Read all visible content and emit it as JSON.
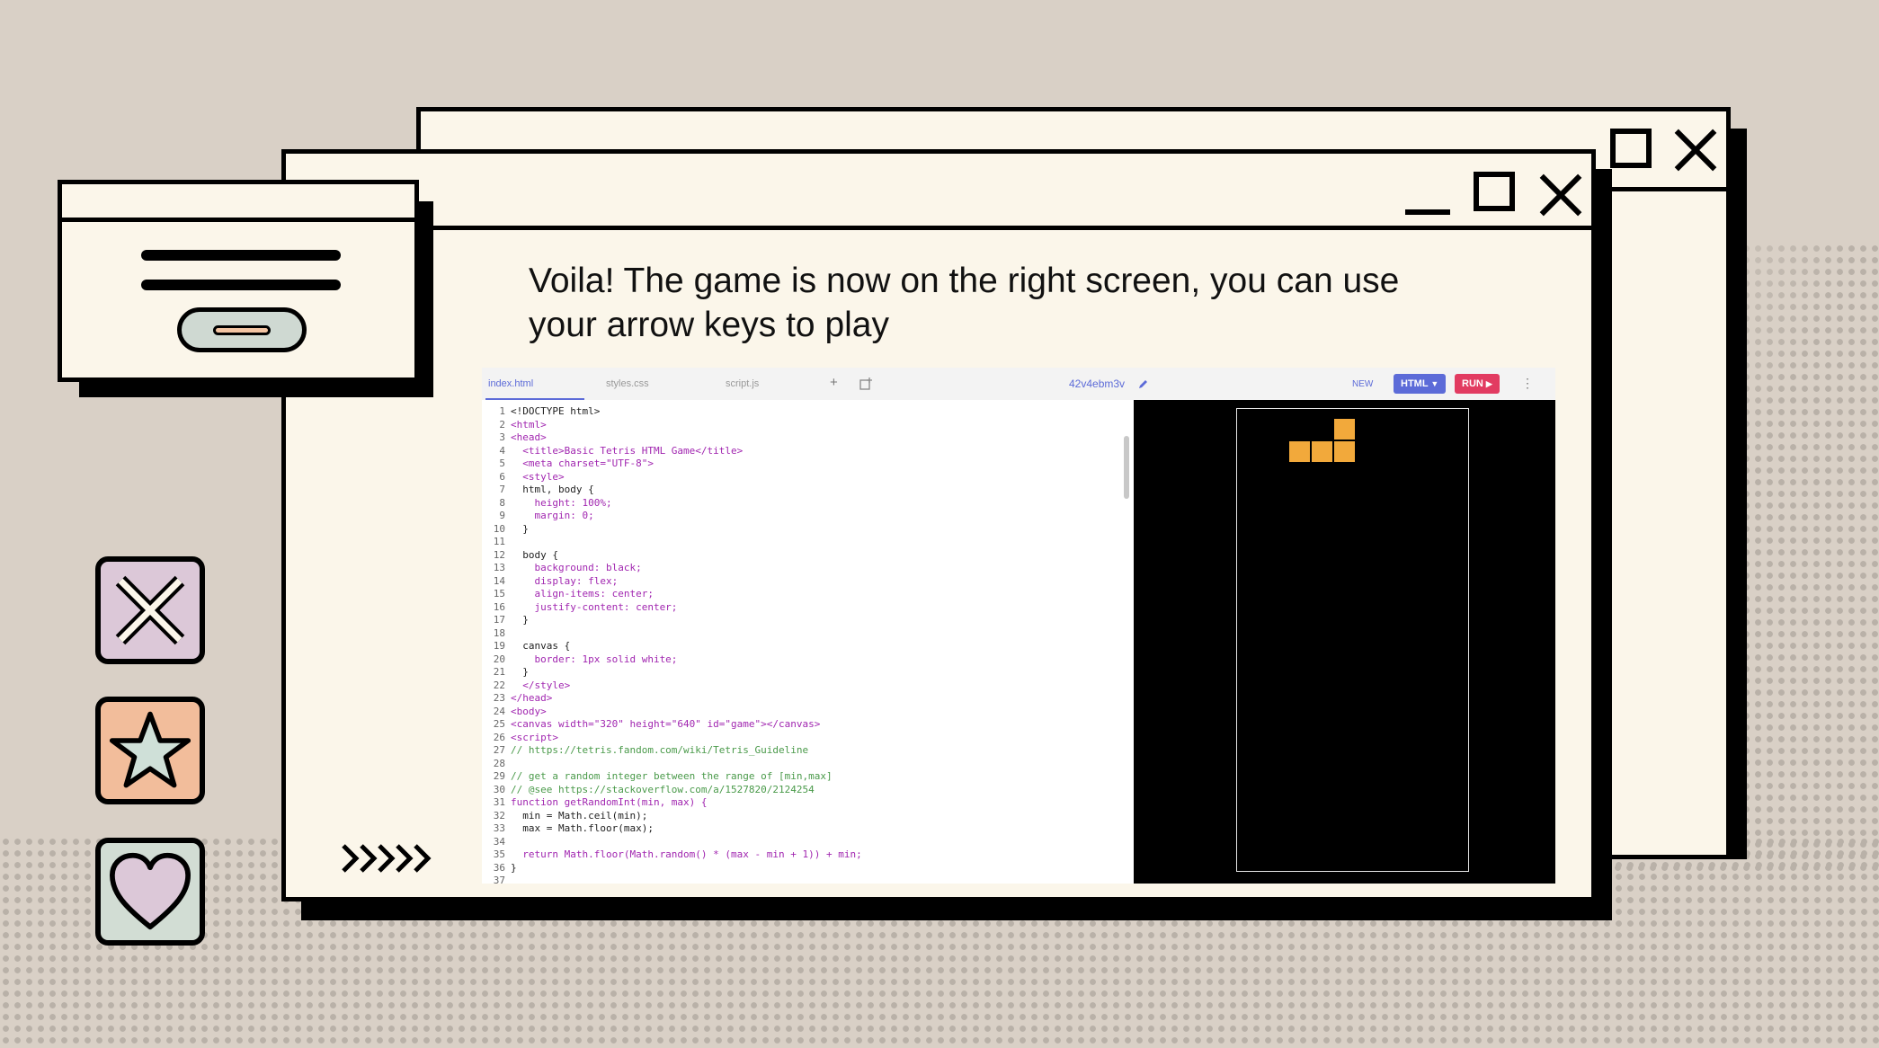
{
  "caption": {
    "line1": "Voila! The game is now on the right screen, you can use",
    "line2": "your arrow keys to play"
  },
  "side_icons": [
    "close-icon",
    "star-icon",
    "heart-icon"
  ],
  "colors": {
    "background": "#d9d0c6",
    "window": "#fbf6ea",
    "close_tile": "#dcc8d8",
    "star_tile": "#f2bd9b",
    "heart_tile": "#d2ddd4",
    "tetris_piece": "#f2a93b"
  },
  "editor": {
    "tabs": [
      "index.html",
      "styles.css",
      "script.js"
    ],
    "add_tab": "+",
    "project_id": "42v4ebm3v",
    "new_label": "NEW",
    "html_label": "HTML",
    "run_label": "RUN",
    "code_lines": [
      "<!DOCTYPE html>",
      "<html>",
      "<head>",
      "  <title>Basic Tetris HTML Game</title>",
      "  <meta charset=\"UTF-8\">",
      "  <style>",
      "  html, body {",
      "    height: 100%;",
      "    margin: 0;",
      "  }",
      "",
      "  body {",
      "    background: black;",
      "    display: flex;",
      "    align-items: center;",
      "    justify-content: center;",
      "  }",
      "",
      "  canvas {",
      "    border: 1px solid white;",
      "  }",
      "  </style>",
      "</head>",
      "<body>",
      "<canvas width=\"320\" height=\"640\" id=\"game\"></canvas>",
      "<script>",
      "// https://tetris.fandom.com/wiki/Tetris_Guideline",
      "",
      "// get a random integer between the range of [min,max]",
      "// @see https://stackoverflow.com/a/1527820/2124254",
      "function getRandomInt(min, max) {",
      "  min = Math.ceil(min);",
      "  max = Math.floor(max);",
      "",
      "  return Math.floor(Math.random() * (max - min + 1)) + min;",
      "}",
      ""
    ],
    "line_numbers": [
      "1",
      "2",
      "3",
      "4",
      "5",
      "6",
      "7",
      "8",
      "9",
      "10",
      "11",
      "12",
      "13",
      "14",
      "15",
      "16",
      "17",
      "18",
      "19",
      "20",
      "21",
      "22",
      "23",
      "24",
      "25",
      "26",
      "27",
      "28",
      "29",
      "30",
      "31",
      "32",
      "33",
      "34",
      "35",
      "36",
      "37"
    ]
  }
}
